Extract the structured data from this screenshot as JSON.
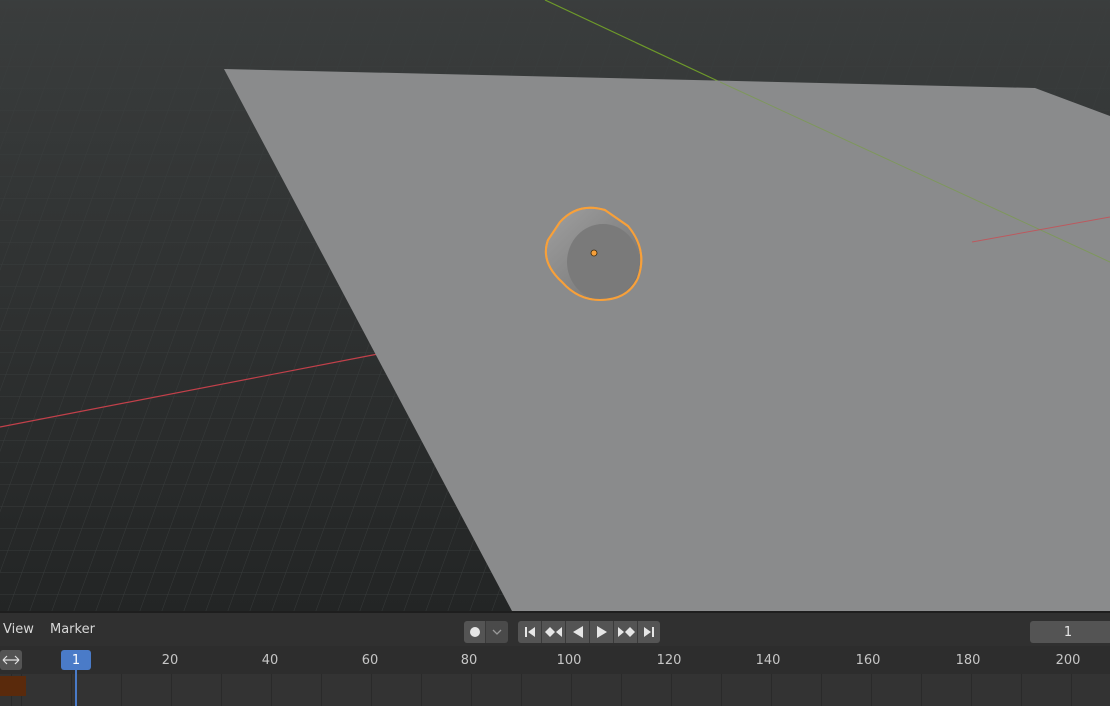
{
  "viewport": {
    "colors": {
      "background": "#2b2e2e",
      "plane": "#8a8b8c",
      "selection_outline": "#f7a03a",
      "x_axis": "#c2404a",
      "y_axis": "#6e9a2a"
    },
    "objects": [
      "ground-plane",
      "cylinder (selected)"
    ]
  },
  "timeline": {
    "menu": {
      "view": "View",
      "marker": "Marker"
    },
    "controls": {
      "record_icon": "record-icon",
      "record_dropdown_icon": "chevron-down-icon",
      "playback_icons": [
        "jump-to-start-icon",
        "prev-keyframe-icon",
        "play-reverse-icon",
        "play-icon",
        "next-keyframe-icon",
        "jump-to-end-icon"
      ]
    },
    "current_frame": "1",
    "ruler": {
      "current_badge": "1",
      "ticks": [
        "20",
        "40",
        "60",
        "80",
        "100",
        "120",
        "140",
        "160",
        "180",
        "200"
      ]
    },
    "scroll_icon": "scrub-arrows-icon",
    "colors": {
      "playhead": "#4a7bc8",
      "keyframe_area": "#5a2a0c"
    }
  }
}
